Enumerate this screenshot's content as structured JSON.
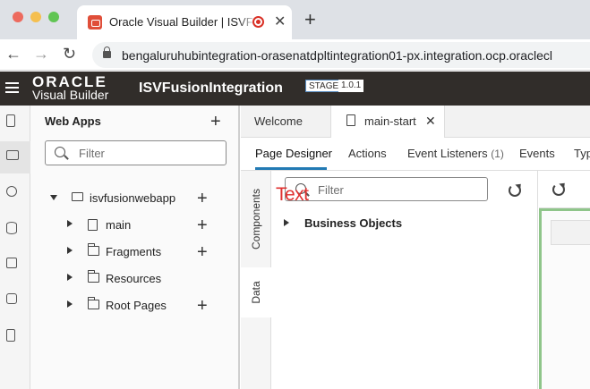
{
  "browser": {
    "tab_title": "Oracle Visual Builder | ISVF",
    "tab_close": "✕",
    "new_tab": "+",
    "nav_back": "←",
    "nav_forward": "→",
    "nav_reload": "↻",
    "url": "bengaluruhubintegration-orasenatdpltintegration01-px.integration.ocp.oraclecl"
  },
  "header": {
    "logo_oracle": "ORACLE",
    "logo_product": "Visual Builder",
    "project_name": "ISVFusionIntegration",
    "stage_badge": "STAGE",
    "version_badge": "1.0.1"
  },
  "navigator": {
    "title": "Web Apps",
    "add": "+",
    "filter_placeholder": "Filter",
    "tree": {
      "app": "isvfusionwebapp",
      "items": [
        {
          "label": "main"
        },
        {
          "label": "Fragments"
        },
        {
          "label": "Resources"
        },
        {
          "label": "Root Pages"
        }
      ]
    }
  },
  "editor": {
    "tabs": [
      {
        "label": "Welcome"
      },
      {
        "label": "main-start"
      }
    ],
    "tab_close": "✕",
    "designer_tabs": [
      {
        "label": "Page Designer"
      },
      {
        "label": "Actions"
      },
      {
        "label": "Event Listeners",
        "count": "(1)"
      },
      {
        "label": "Events"
      },
      {
        "label": "Typ"
      }
    ],
    "vertical_tabs": [
      {
        "label": "Components"
      },
      {
        "label": "Data"
      }
    ],
    "data_panel": {
      "filter_placeholder": "Filter",
      "overlay_text": "Text",
      "section": "Business Objects"
    }
  },
  "colors": {
    "header_bg": "#312d2a",
    "accent_blue": "#227ab4",
    "canvas_green": "#8fc58a",
    "overlay_red": "#e0302f"
  }
}
